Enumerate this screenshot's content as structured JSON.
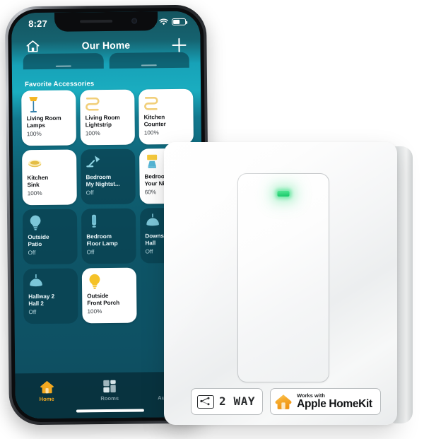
{
  "scene": {
    "description": "Product photo: smart wall light switch next to an iPhone showing the Apple Home app",
    "background_color": "#ffffff"
  },
  "phone": {
    "status_bar": {
      "time": "8:27",
      "location_arrow_icon": "location-arrow-icon",
      "signal_icon": "cellular-bars-icon",
      "wifi_icon": "wifi-icon",
      "battery_icon": "battery-icon"
    },
    "nav": {
      "home_icon": "house-icon",
      "title": "Our Home",
      "add_icon": "plus-icon"
    },
    "section_label": "Favorite Accessories",
    "tiles": [
      {
        "name": "Living Room\nLamps",
        "state": "100%",
        "on": true,
        "icon": "floor-lamp-icon",
        "icon_color": "#f5b521"
      },
      {
        "name": "Living Room\nLightstrip",
        "state": "100%",
        "on": true,
        "icon": "lightstrip-icon",
        "icon_color": "#f1cf7a"
      },
      {
        "name": "Kitchen\nCounter",
        "state": "100%",
        "on": true,
        "icon": "lightstrip-icon",
        "icon_color": "#f1cf7a"
      },
      {
        "name": "Kitchen\nSink",
        "state": "100%",
        "on": true,
        "icon": "recessed-light-icon",
        "icon_color": "#e8c352"
      },
      {
        "name": "Bedroom\nMy Nightst...",
        "state": "Off",
        "on": false,
        "icon": "desk-lamp-icon",
        "icon_color": "#8fd4e3"
      },
      {
        "name": "Bedroom\nYour Nig...",
        "state": "60%",
        "on": true,
        "icon": "table-lamp-icon",
        "icon_color": "#f5c93c"
      },
      {
        "name": "Outside\nPatio",
        "state": "Off",
        "on": false,
        "icon": "bulb-icon",
        "icon_color": "#7cc6d8"
      },
      {
        "name": "Bedroom\nFloor Lamp",
        "state": "Off",
        "on": false,
        "icon": "torch-lamp-icon",
        "icon_color": "#7cc6d8"
      },
      {
        "name": "Downstai...\nHall",
        "state": "Off",
        "on": false,
        "icon": "pendant-light-icon",
        "icon_color": "#7cc6d8"
      },
      {
        "name": "Hallway 2\nHall 2",
        "state": "Off",
        "on": false,
        "icon": "pendant-light-icon",
        "icon_color": "#7cc6d8"
      },
      {
        "name": "Outside\nFront Porch",
        "state": "100%",
        "on": true,
        "icon": "bulb-icon",
        "icon_color": "#f5c228"
      }
    ],
    "tabs": [
      {
        "label": "Home",
        "icon": "house-icon",
        "active": true
      },
      {
        "label": "Rooms",
        "icon": "rooms-grid-icon",
        "active": false
      },
      {
        "label": "Automation",
        "icon": "automation-icon",
        "active": false
      }
    ]
  },
  "switch_device": {
    "led_indicator": {
      "name": "status-led",
      "color": "#22d46f",
      "state": "on"
    },
    "badges": [
      {
        "id": "two-way",
        "icon": "wiring-diagram-icon",
        "label": "2 WAY"
      },
      {
        "id": "apple-homekit",
        "icon": "homekit-house-icon",
        "line1": "Works with",
        "line2": "Apple HomeKit",
        "icon_color": "#f5a623"
      }
    ]
  },
  "colors": {
    "app_accent": "#17a2b8",
    "app_background": "#0e5567",
    "tile_on": "#ffffff",
    "tile_off": "rgba(10,64,79,0.72)",
    "tab_active": "#f3a920",
    "led_green": "#22d46f",
    "homekit_orange": "#f5a623"
  }
}
